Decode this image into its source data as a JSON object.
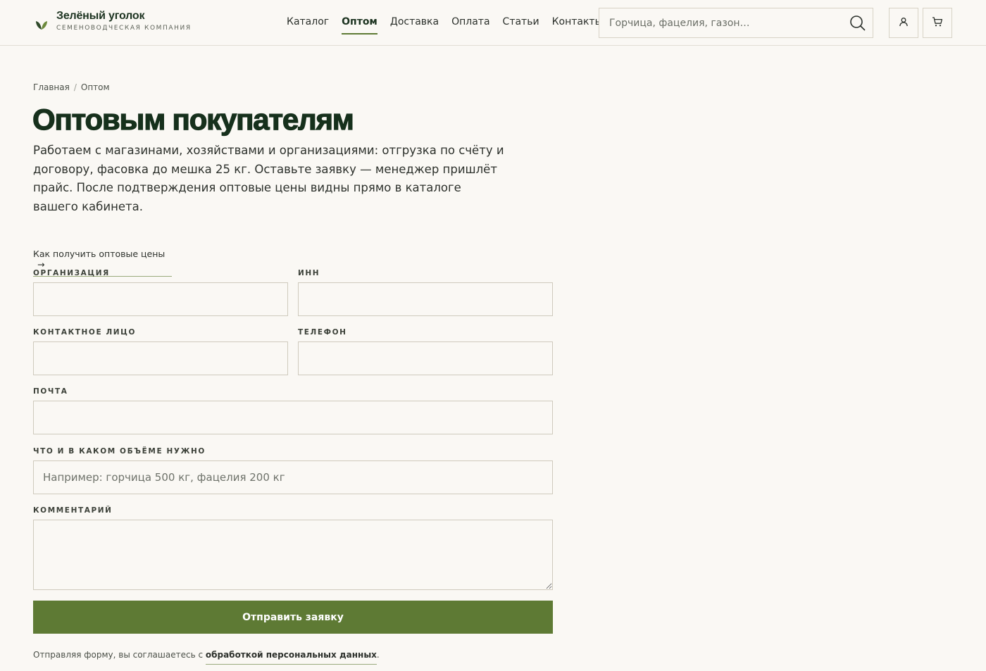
{
  "brand": {
    "name": "Зелёный уголок",
    "tagline": "СЕМЕНОВОДЧЕСКАЯ КОМПАНИЯ"
  },
  "nav": [
    {
      "label": "Каталог",
      "active": false
    },
    {
      "label": "Оптом",
      "active": true
    },
    {
      "label": "Доставка",
      "active": false
    },
    {
      "label": "Оплата",
      "active": false
    },
    {
      "label": "Статьи",
      "active": false
    },
    {
      "label": "Контакты",
      "active": false
    }
  ],
  "search": {
    "placeholder": "Горчица, фацелия, газон…",
    "value": ""
  },
  "icons": {
    "search": "search-icon",
    "account": "user-icon",
    "cart": "cart-icon",
    "logo": "leaf-icon"
  },
  "breadcrumb": {
    "home": "Главная",
    "separator": "/",
    "current": "Оптом"
  },
  "page": {
    "title": "Оптовым покупателям",
    "lead": "Работаем с магазинами, хозяйствами и организациями: отгрузка по счёту и договору, фасовка до мешка 25 кг. Оставьте заявку — менеджер пришлёт прайс. После подтверждения оптовые цены видны прямо в каталоге вашего кабинета.",
    "howto_link": "Как получить оптовые цены",
    "howto_arrow": "→"
  },
  "form": {
    "organization": {
      "label": "ОРГАНИЗАЦИЯ",
      "value": ""
    },
    "inn": {
      "label": "ИНН",
      "value": ""
    },
    "contact": {
      "label": "КОНТАКТНОЕ ЛИЦО",
      "value": ""
    },
    "phone": {
      "label": "ТЕЛЕФОН",
      "value": ""
    },
    "email": {
      "label": "ПОЧТА",
      "value": ""
    },
    "needs": {
      "label": "ЧТО И В КАКОМ ОБЪЁМЕ НУЖНО",
      "placeholder": "Например: горчица 500 кг, фацелия 200 кг",
      "value": ""
    },
    "comment": {
      "label": "КОММЕНТАРИЙ",
      "value": ""
    },
    "submit_label": "Отправить заявку",
    "consent_prefix": "Отправляя форму, вы соглашаетесь с ",
    "consent_link": "обработкой персональных данных",
    "consent_suffix": "."
  },
  "colors": {
    "accent": "#5e7a34",
    "background": "#faf8f4",
    "title": "#16301c"
  }
}
